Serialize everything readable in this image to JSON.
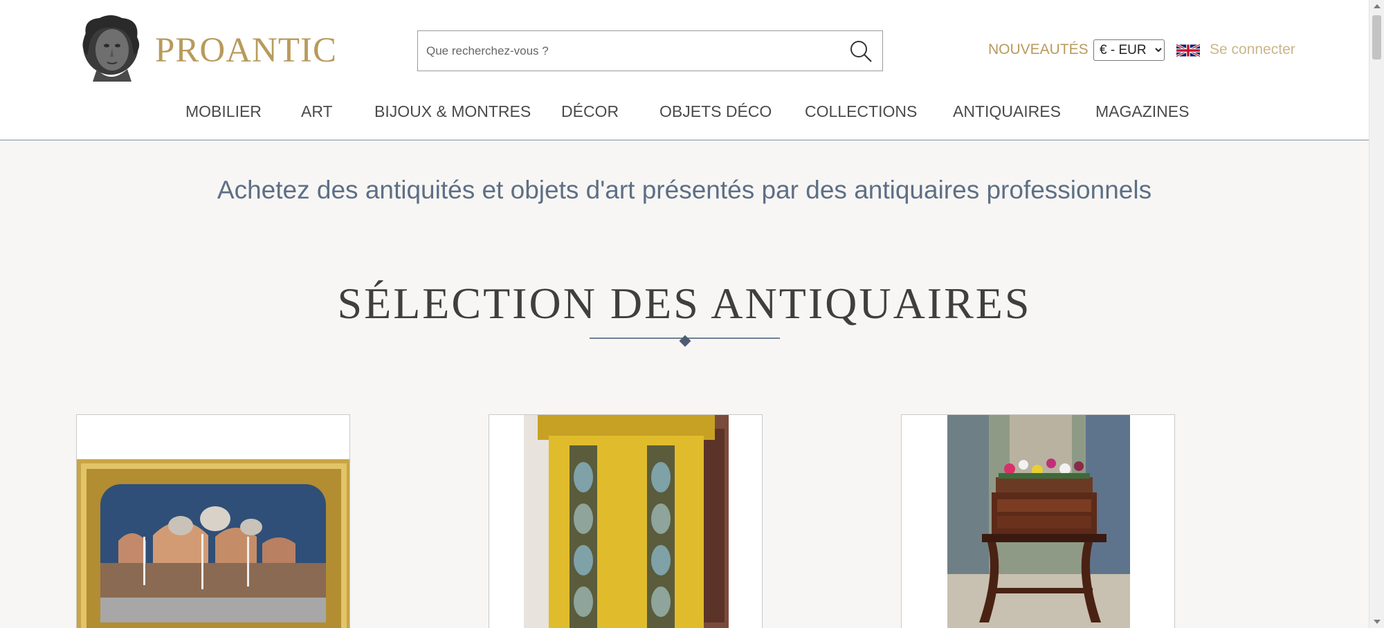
{
  "header": {
    "logo_text": "PROANTIC",
    "search": {
      "placeholder": "Que recherchez-vous ?"
    },
    "news_label": "NOUVEAUTÉS",
    "currency": {
      "selected": "€ - EUR"
    },
    "language_icon": "uk-flag-icon",
    "login_label": "Se connecter"
  },
  "nav": {
    "items": [
      {
        "label": "MOBILIER"
      },
      {
        "label": "ART"
      },
      {
        "label": "BIJOUX & MONTRES"
      },
      {
        "label": "DÉCOR"
      },
      {
        "label": "OBJETS DÉCO"
      },
      {
        "label": "COLLECTIONS"
      },
      {
        "label": "ANTIQUAIRES"
      },
      {
        "label": "MAGAZINES"
      }
    ]
  },
  "main": {
    "tagline": "Achetez des antiquités et objets d'art présentés par des antiquaires professionnels",
    "section_title": "SÉLECTION DES ANTIQUAIRES",
    "cards": [
      {
        "image": "venice-painting-image"
      },
      {
        "image": "gilded-column-image"
      },
      {
        "image": "mahogany-table-image"
      }
    ]
  },
  "colors": {
    "brand_gold": "#b89a5c",
    "login_gold": "#cbb68b",
    "tagline_blue": "#5e6f86",
    "background": "#f7f6f4"
  }
}
